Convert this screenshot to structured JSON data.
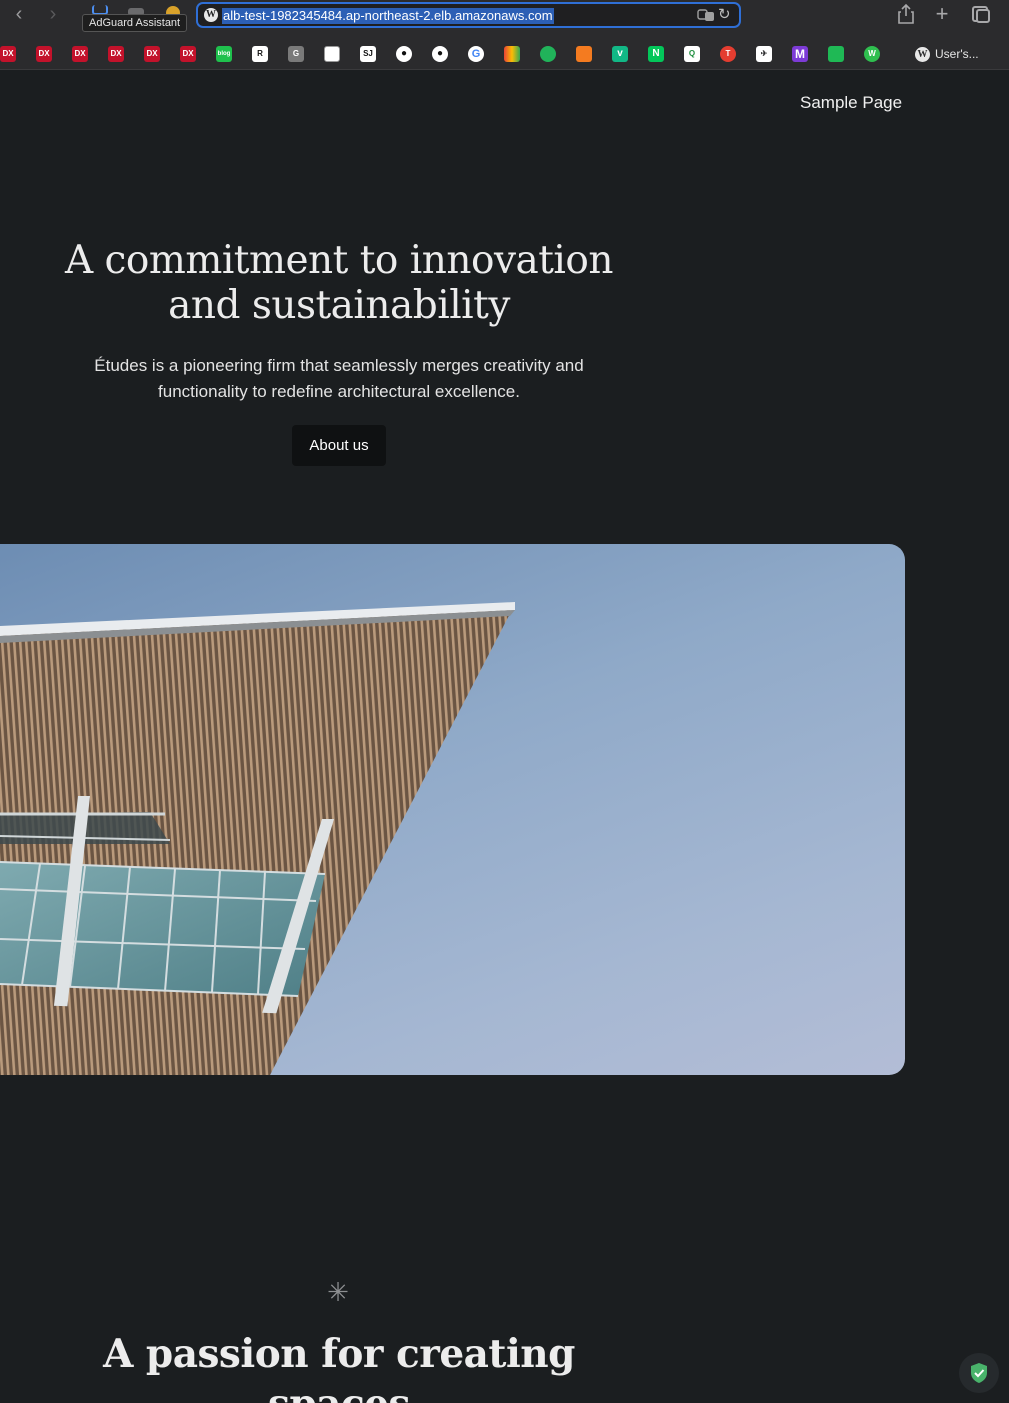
{
  "browser": {
    "tooltip": "AdGuard Assistant",
    "url": "alb-test-1982345484.ap-northeast-2.elb.amazonaws.com",
    "bookmark_user_label": "User's..."
  },
  "site": {
    "nav": {
      "sample_page": "Sample Page"
    },
    "hero": {
      "title_line1": "A commitment to innovation",
      "title_line2": "and sustainability",
      "text_line1": "Études is a pioneering firm that seamlessly merges creativity and",
      "text_line2": "functionality to redefine architectural excellence.",
      "button": "About us"
    },
    "section": {
      "asterisk": "✳",
      "title": "A passion for creating spaces"
    }
  }
}
